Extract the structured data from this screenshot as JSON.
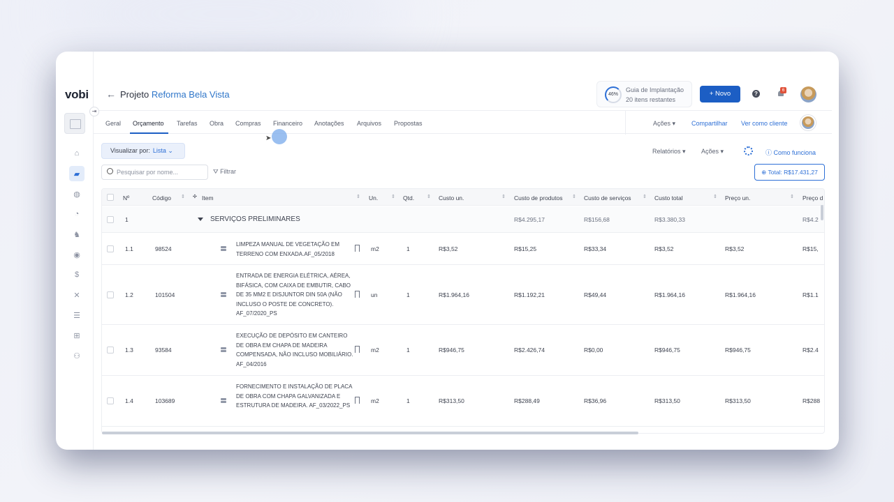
{
  "app": {
    "logo": "vobi"
  },
  "header": {
    "back_icon": "arrow-left-icon",
    "title_prefix": "Projeto",
    "project_name": "Reforma Bela Vista",
    "guide": {
      "percent": "46%",
      "title": "Guia de Implantação",
      "subtitle": "20 itens restantes"
    },
    "new_button": "+ Novo",
    "notifications_count": "6"
  },
  "tabs": [
    "Geral",
    "Orçamento",
    "Tarefas",
    "Obra",
    "Compras",
    "Financeiro",
    "Anotações",
    "Arquivos",
    "Propostas"
  ],
  "active_tab": "Orçamento",
  "tab_actions": {
    "acoes": "Ações",
    "share": "Compartilhar",
    "view_as_client": "Ver como cliente"
  },
  "toolbar": {
    "view_label": "Visualizar por:",
    "view_value": "Lista",
    "relatorios": "Relatórios",
    "acoes": "Ações",
    "como_funciona": "Como funciona",
    "search_placeholder": "Pesquisar por nome...",
    "filter": "Filtrar",
    "total": "Total: R$17.431,27"
  },
  "table": {
    "headers": [
      "Nº",
      "Código",
      "Item",
      "Un.",
      "Qtd.",
      "Custo un.",
      "Custo de produtos",
      "Custo de serviços",
      "Custo total",
      "Preço un.",
      "Preço d"
    ],
    "group": {
      "num": "1",
      "title": "SERVIÇOS PRELIMINARES",
      "custo_produtos": "R$4.295,17",
      "custo_servicos": "R$156,68",
      "custo_total": "R$3.380,33",
      "preco": "R$4.2"
    },
    "rows": [
      {
        "num": "1.1",
        "code": "98524",
        "desc": "LIMPEZA MANUAL DE VEGETAÇÃO EM TERRENO COM ENXADA.AF_05/2018",
        "un": "m2",
        "qtd": "1",
        "custo_un": "R$3,52",
        "custo_prod": "R$15,25",
        "custo_serv": "R$33,34",
        "custo_total": "R$3,52",
        "preco_un": "R$3,52",
        "preco_d": "R$15,"
      },
      {
        "num": "1.2",
        "code": "101504",
        "desc": "ENTRADA DE ENERGIA ELÉTRICA, AÉREA, BIFÁSICA, COM CAIXA DE EMBUTIR, CABO DE 35 MM2 E DISJUNTOR DIN 50A (NÃO INCLUSO O POSTE DE CONCRETO). AF_07/2020_PS",
        "un": "un",
        "qtd": "1",
        "custo_un": "R$1.964,16",
        "custo_prod": "R$1.192,21",
        "custo_serv": "R$49,44",
        "custo_total": "R$1.964,16",
        "preco_un": "R$1.964,16",
        "preco_d": "R$1.1"
      },
      {
        "num": "1.3",
        "code": "93584",
        "desc": "EXECUÇÃO DE DEPÓSITO EM CANTEIRO DE OBRA EM CHAPA DE MADEIRA COMPENSADA, NÃO INCLUSO MOBILIÁRIO. AF_04/2016",
        "un": "m2",
        "qtd": "1",
        "custo_un": "R$946,75",
        "custo_prod": "R$2.426,74",
        "custo_serv": "R$0,00",
        "custo_total": "R$946,75",
        "preco_un": "R$946,75",
        "preco_d": "R$2.4"
      },
      {
        "num": "1.4",
        "code": "103689",
        "desc": "FORNECIMENTO E INSTALAÇÃO DE PLACA DE OBRA COM CHAPA GALVANIZADA E ESTRUTURA DE MADEIRA. AF_03/2022_PS",
        "un": "m2",
        "qtd": "1",
        "custo_un": "R$313,50",
        "custo_prod": "R$288,49",
        "custo_serv": "R$36,96",
        "custo_total": "R$313,50",
        "preco_un": "R$313,50",
        "preco_d": "R$288"
      }
    ]
  },
  "sidebar_icons": [
    "home-icon",
    "folder-icon",
    "handshake-icon",
    "money-icon",
    "worker-icon",
    "coins-icon",
    "dollar-icon",
    "tools-icon",
    "list-icon",
    "apps-icon",
    "team-icon"
  ],
  "colors": {
    "accent": "#1c5ec4",
    "link": "#2d6fd6",
    "badge": "#e0523a"
  }
}
